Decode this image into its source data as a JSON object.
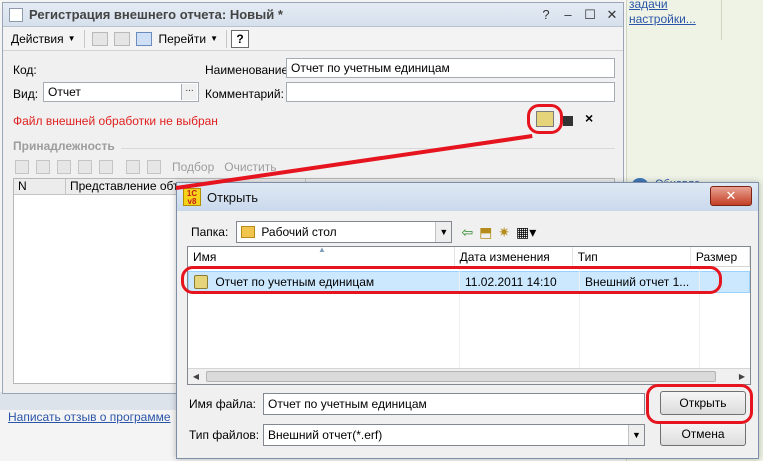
{
  "background": {
    "task_link_1": "задачи",
    "task_link_2": "настройки...",
    "rss_label": "Обновле...",
    "feedback_link": "Написать отзыв о программе"
  },
  "registration": {
    "title": "Регистрация внешнего отчета: Новый *",
    "toolbar": {
      "actions": "Действия",
      "goto": "Перейти",
      "help": "?"
    },
    "code_label": "Код:",
    "name_label": "Наименование:",
    "name_value": "Отчет по учетным единицам",
    "kind_label": "Вид:",
    "kind_value": "Отчет",
    "comment_label": "Комментарий:",
    "comment_value": "",
    "file_error": "Файл внешней обработки не выбран",
    "belonging_label": "Принадлежность",
    "selection_label": "Подбор",
    "clear_label": "Очистить",
    "col_n": "N",
    "col_repr": "Представление объе"
  },
  "dialog": {
    "title": "Открыть",
    "logo_text": "1С v8",
    "close": "✕",
    "folder_label": "Папка:",
    "folder_value": "Рабочий стол",
    "columns": [
      "Имя",
      "Дата изменения",
      "Тип",
      "Размер"
    ],
    "file_row": {
      "name": "Отчет по учетным единицам",
      "date": "11.02.2011 14:10",
      "type": "Внешний отчет 1..."
    },
    "filename_label": "Имя файла:",
    "filename_value": "Отчет по учетным единицам",
    "filetype_label": "Тип файлов:",
    "filetype_value": "Внешний отчет(*.erf)",
    "open_button": "Открыть",
    "cancel_button": "Отмена"
  },
  "colors": {
    "annotation": "#e6141e",
    "error": "#e02020",
    "selection": "#cce8ff"
  }
}
